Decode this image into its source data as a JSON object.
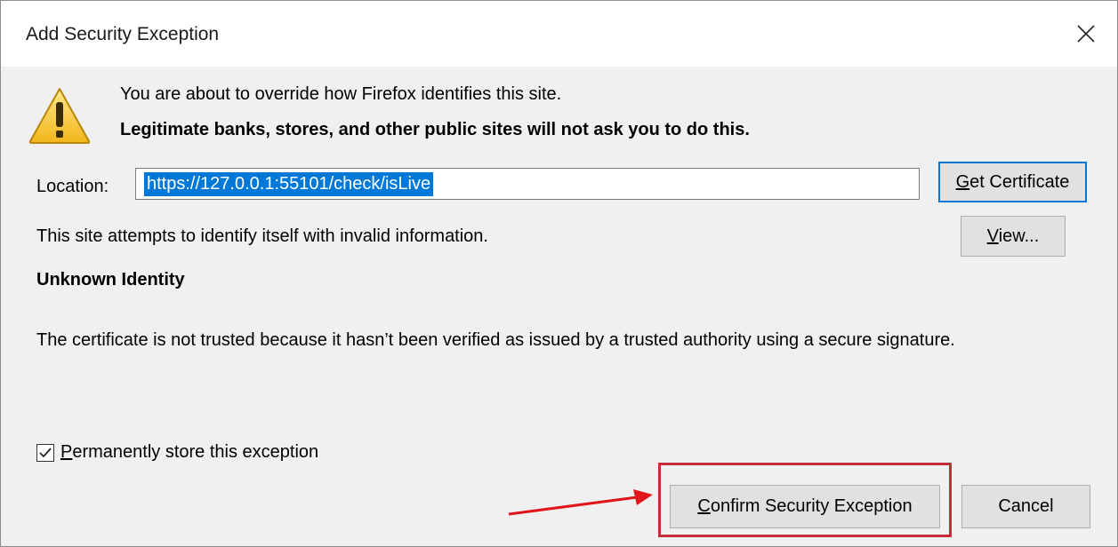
{
  "dialog": {
    "title": "Add Security Exception",
    "close_icon": "close-icon",
    "warning_icon": "warning-icon",
    "warning_line1": "You are about to override how Firefox identifies this site.",
    "warning_line2": "Legitimate banks, stores, and other public sites will not ask you to do this.",
    "location_label": "Location:",
    "location_value": "https://127.0.0.1:55101/check/isLive",
    "get_certificate_label": "Get Certificate",
    "identify_text": "This site attempts to identify itself with invalid information.",
    "view_label": "View...",
    "identity_heading": "Unknown Identity",
    "certificate_text": "The certificate is not trusted because it hasn’t been verified as issued by a trusted authority using a secure signature.",
    "permanent_label": "Permanently store this exception",
    "permanent_checked": true,
    "confirm_label": "Confirm Security Exception",
    "cancel_label": "Cancel"
  },
  "annotation": {
    "highlight_color": "#c62b3a",
    "arrow_color": "#e0161b"
  },
  "colors": {
    "selection": "#0078d7",
    "dialog_bg": "#f0f0f0",
    "button_bg": "#e1e1e1"
  }
}
